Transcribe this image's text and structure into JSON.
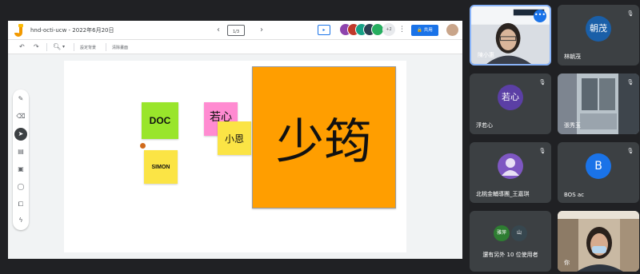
{
  "jamboard": {
    "doc_title": "hnd-octi-ucw - 2022年6月20日",
    "frame_counter": "1/3",
    "avatar_extra_count": "+2",
    "share_label": "共用",
    "zoom_indicator": "⊕",
    "set_background_label": "設定背景",
    "clear_frame_label": "清除畫面",
    "icons": [
      "jamboard-logo",
      "undo-icon",
      "redo-icon",
      "zoom-icon",
      "pen-icon",
      "eraser-icon",
      "select-icon",
      "sticky-note-icon",
      "image-icon",
      "circle-icon",
      "textbox-icon",
      "laser-icon"
    ]
  },
  "notes": {
    "doc": "DOC",
    "simon": "SIMON",
    "ruoxin": "若心",
    "xiaoen": "小恩",
    "shaoqi": "少筠"
  },
  "colors": {
    "accent_blue": "#1a73e8",
    "note_green": "#99e52b",
    "note_yellow": "#fbe445",
    "note_pink": "#ff8bd1",
    "note_orange": "#ff9e00"
  },
  "participants": [
    {
      "name": "陳小惠",
      "initial": "",
      "type": "video"
    },
    {
      "name": "林朝茂",
      "initial": "朝茂",
      "type": "avatar",
      "color": "#1a5fa8"
    },
    {
      "name": "浮若心",
      "initial": "若心",
      "type": "avatar",
      "color": "#5b3fa5"
    },
    {
      "name": "張秀玉",
      "initial": "",
      "type": "video"
    },
    {
      "name": "北桃金輔導團_王嘉琪",
      "initial": "",
      "type": "avatar",
      "color": "#7e57c2"
    },
    {
      "name": "BOS ac",
      "initial": "B",
      "type": "avatar",
      "color": "#1a73e8"
    },
    {
      "name": "還有另外 10 位使用者",
      "initial": "",
      "type": "others"
    },
    {
      "name": "你",
      "initial": "",
      "type": "video"
    }
  ],
  "others_avatars": [
    "雅萍",
    "山"
  ]
}
